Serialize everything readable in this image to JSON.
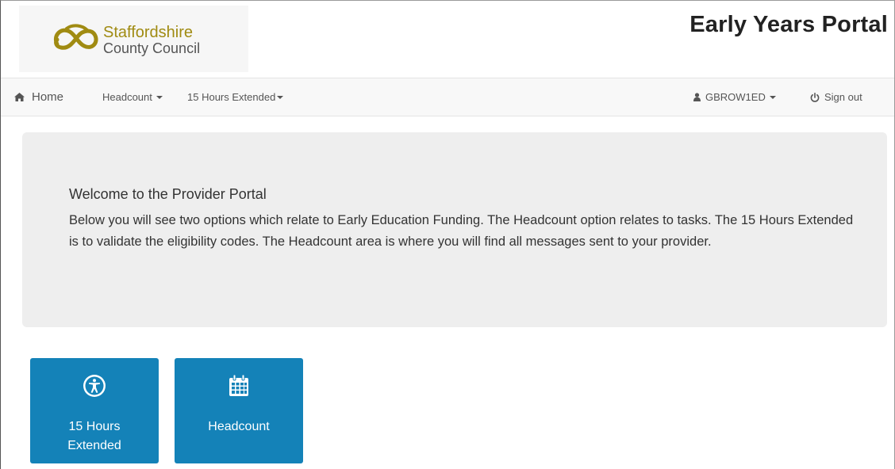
{
  "header": {
    "logo": {
      "line1": "Staffordshire",
      "line2": "County Council",
      "brand_color": "#a08b12"
    },
    "portal_title": "Early Years Portal"
  },
  "navbar": {
    "home": {
      "label": "Home",
      "icon": "home-icon"
    },
    "headcount": {
      "label": "Headcount"
    },
    "extended": {
      "label": "15 Hours Extended"
    },
    "user": {
      "label": "GBROW1ED",
      "icon": "user-icon"
    },
    "signout": {
      "label": "Sign out",
      "icon": "power-icon"
    }
  },
  "welcome": {
    "heading": "Welcome to the Provider Portal",
    "body": "Below you will see two options which relate to Early Education Funding. The Headcount option relates to tasks. The 15 Hours Extended is to validate the eligibility codes. The Headcount area is where you will find all messages sent to your provider."
  },
  "tiles": [
    {
      "label_line1": "15 Hours",
      "label_line2": "Extended",
      "icon": "accessibility-icon"
    },
    {
      "label": "Headcount",
      "icon": "calendar-icon"
    }
  ],
  "colors": {
    "tile_bg": "#1482b8",
    "jumbotron_bg": "#eeeeee",
    "navbar_bg": "#f8f8f8"
  }
}
